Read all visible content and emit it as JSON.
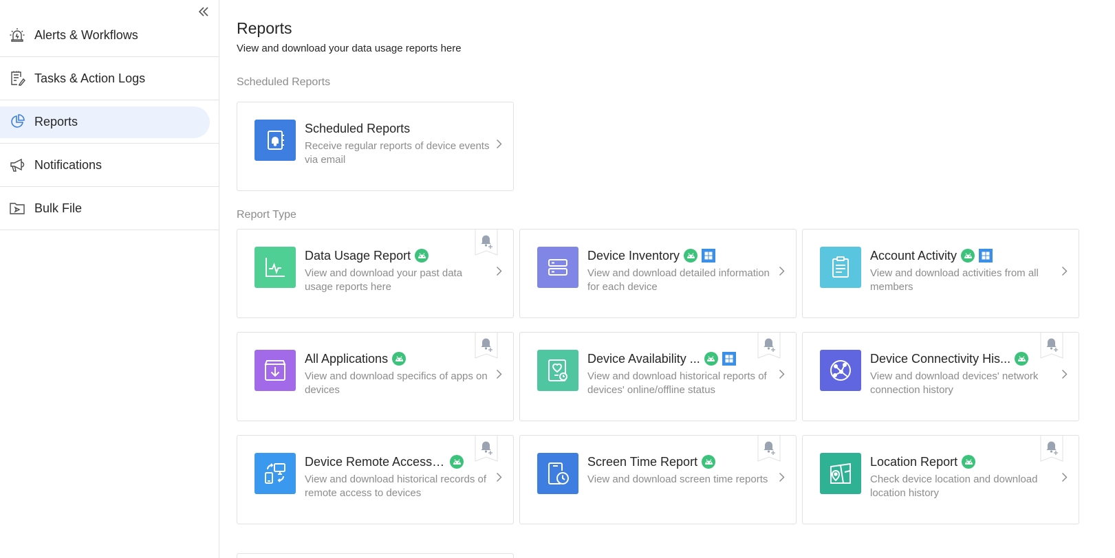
{
  "sidebar": {
    "items": [
      {
        "label": "Alerts & Workflows",
        "icon": "alarm-icon",
        "active": false
      },
      {
        "label": "Tasks & Action Logs",
        "icon": "task-list-icon",
        "active": false
      },
      {
        "label": "Reports",
        "icon": "pie-chart-icon",
        "active": true
      },
      {
        "label": "Notifications",
        "icon": "megaphone-icon",
        "active": false
      },
      {
        "label": "Bulk File",
        "icon": "folder-send-icon",
        "active": false
      }
    ]
  },
  "header": {
    "title": "Reports",
    "subtitle": "View and download your data usage reports here"
  },
  "sections": {
    "scheduled": "Scheduled Reports",
    "report_type": "Report Type"
  },
  "scheduled_card": {
    "title": "Scheduled Reports",
    "desc": "Receive regular reports of device events via email",
    "icon": "notebook-bell-icon",
    "color": "#3d7ee0"
  },
  "report_cards": [
    {
      "title": "Data Usage Report",
      "desc": "View and download your past data usage reports here",
      "icon": "data-usage-icon",
      "color": "#4fcf93",
      "android": true,
      "windows": false
    },
    {
      "title": "Device Inventory",
      "desc": "View and download detailed information for each device",
      "icon": "server-icon",
      "color": "#7f86e6",
      "android": true,
      "windows": true
    },
    {
      "title": "Account Activity",
      "desc": "View and download activities from all members",
      "icon": "clipboard-icon",
      "color": "#59c5de",
      "android": true,
      "windows": true
    },
    {
      "title": "All Applications",
      "desc": "View and download specifics of apps on devices",
      "icon": "download-box-icon",
      "color": "#a26ae8",
      "android": true,
      "windows": false
    },
    {
      "title": "Device Availability ...",
      "desc": "View and download historical reports of devices' online/offline status",
      "icon": "device-heart-icon",
      "color": "#4fc5a0",
      "android": true,
      "windows": true
    },
    {
      "title": "Device Connectivity His...",
      "desc": "View and download devices' network connection history",
      "icon": "network-globe-icon",
      "color": "#5f66e0",
      "android": true,
      "windows": false
    },
    {
      "title": "Device Remote Access ...",
      "desc": "View and download historical records of remote access to devices",
      "icon": "remote-devices-icon",
      "color": "#3b98ef",
      "android": true,
      "windows": false
    },
    {
      "title": "Screen Time Report",
      "desc": "View and download screen time reports",
      "icon": "screen-clock-icon",
      "color": "#3d7ee0",
      "android": true,
      "windows": false
    },
    {
      "title": "Location Report",
      "desc": "Check device location and download location history",
      "icon": "map-pin-icon",
      "color": "#2fb293",
      "android": true,
      "windows": false
    }
  ]
}
